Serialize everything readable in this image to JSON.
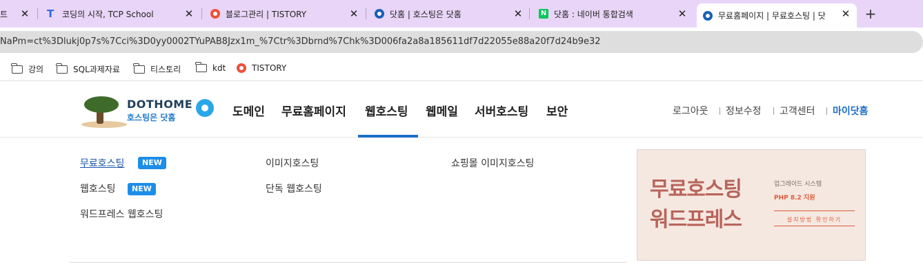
{
  "browser": {
    "tabs": [
      {
        "title": "트",
        "favicon": "none"
      },
      {
        "title": "코딩의 시작, TCP School",
        "favicon": "t-icon"
      },
      {
        "title": "블로그관리 | TISTORY",
        "favicon": "tistory-icon"
      },
      {
        "title": "닷홈 | 호스팅은 닷홈",
        "favicon": "dothome-icon"
      },
      {
        "title": "닷홈 : 네이버 통합검색",
        "favicon": "naver-icon"
      },
      {
        "title": "무료홈페이지 | 무료호스팅 | 닷",
        "favicon": "dothome-icon",
        "active": true
      }
    ],
    "close_glyph": "✕",
    "new_tab_glyph": "+",
    "naver_letter": "N",
    "address": "NaPm=ct%3Dlukj0p7s%7Cci%3D0yy0002TYuPAB8Jzx1m_%7Ctr%3Dbrnd%7Chk%3D006fa2a8a185611df7d22055e88a20f7d24b9e32",
    "bookmarks": [
      {
        "label": "강의",
        "icon": "folder-icon"
      },
      {
        "label": "SQL과제자료",
        "icon": "folder-icon"
      },
      {
        "label": "티스토리",
        "icon": "folder-icon"
      },
      {
        "label": "kdt",
        "icon": "folder-icon"
      },
      {
        "label": "TISTORY",
        "icon": "tistory-icon"
      }
    ]
  },
  "site": {
    "logo": {
      "line1": "DOTHOME",
      "line2": "호스팅은 닷홈"
    },
    "nav": [
      "도메인",
      "무료홈페이지",
      "웹호스팅",
      "웹메일",
      "서버호스팅",
      "보안"
    ],
    "nav_active": "웹호스팅",
    "util": [
      "로그아웃",
      "정보수정",
      "고객센터",
      "마이닷홈"
    ],
    "submenu": {
      "col1": [
        {
          "label": "무료호스팅",
          "badge": "NEW",
          "hover": true
        },
        {
          "label": "웹호스팅",
          "badge": "NEW"
        },
        {
          "label": "워드프레스 웹호스팅"
        }
      ],
      "col2": [
        {
          "label": "이미지호스팅"
        },
        {
          "label": "단독 웹호스팅"
        }
      ],
      "col3": [
        {
          "label": "쇼핑몰 이미지호스팅"
        }
      ]
    },
    "banner": {
      "line1": "무료호스팅",
      "line2": "워드프레스",
      "upgrade": "업그레이드 시스템",
      "php": "PHP 8.2 지원",
      "link": "설치방법 확인하기"
    },
    "colors": {
      "accent": "#1c6fc6",
      "badge": "#1d8de8",
      "tab_strip": "#e9d5f7"
    }
  }
}
